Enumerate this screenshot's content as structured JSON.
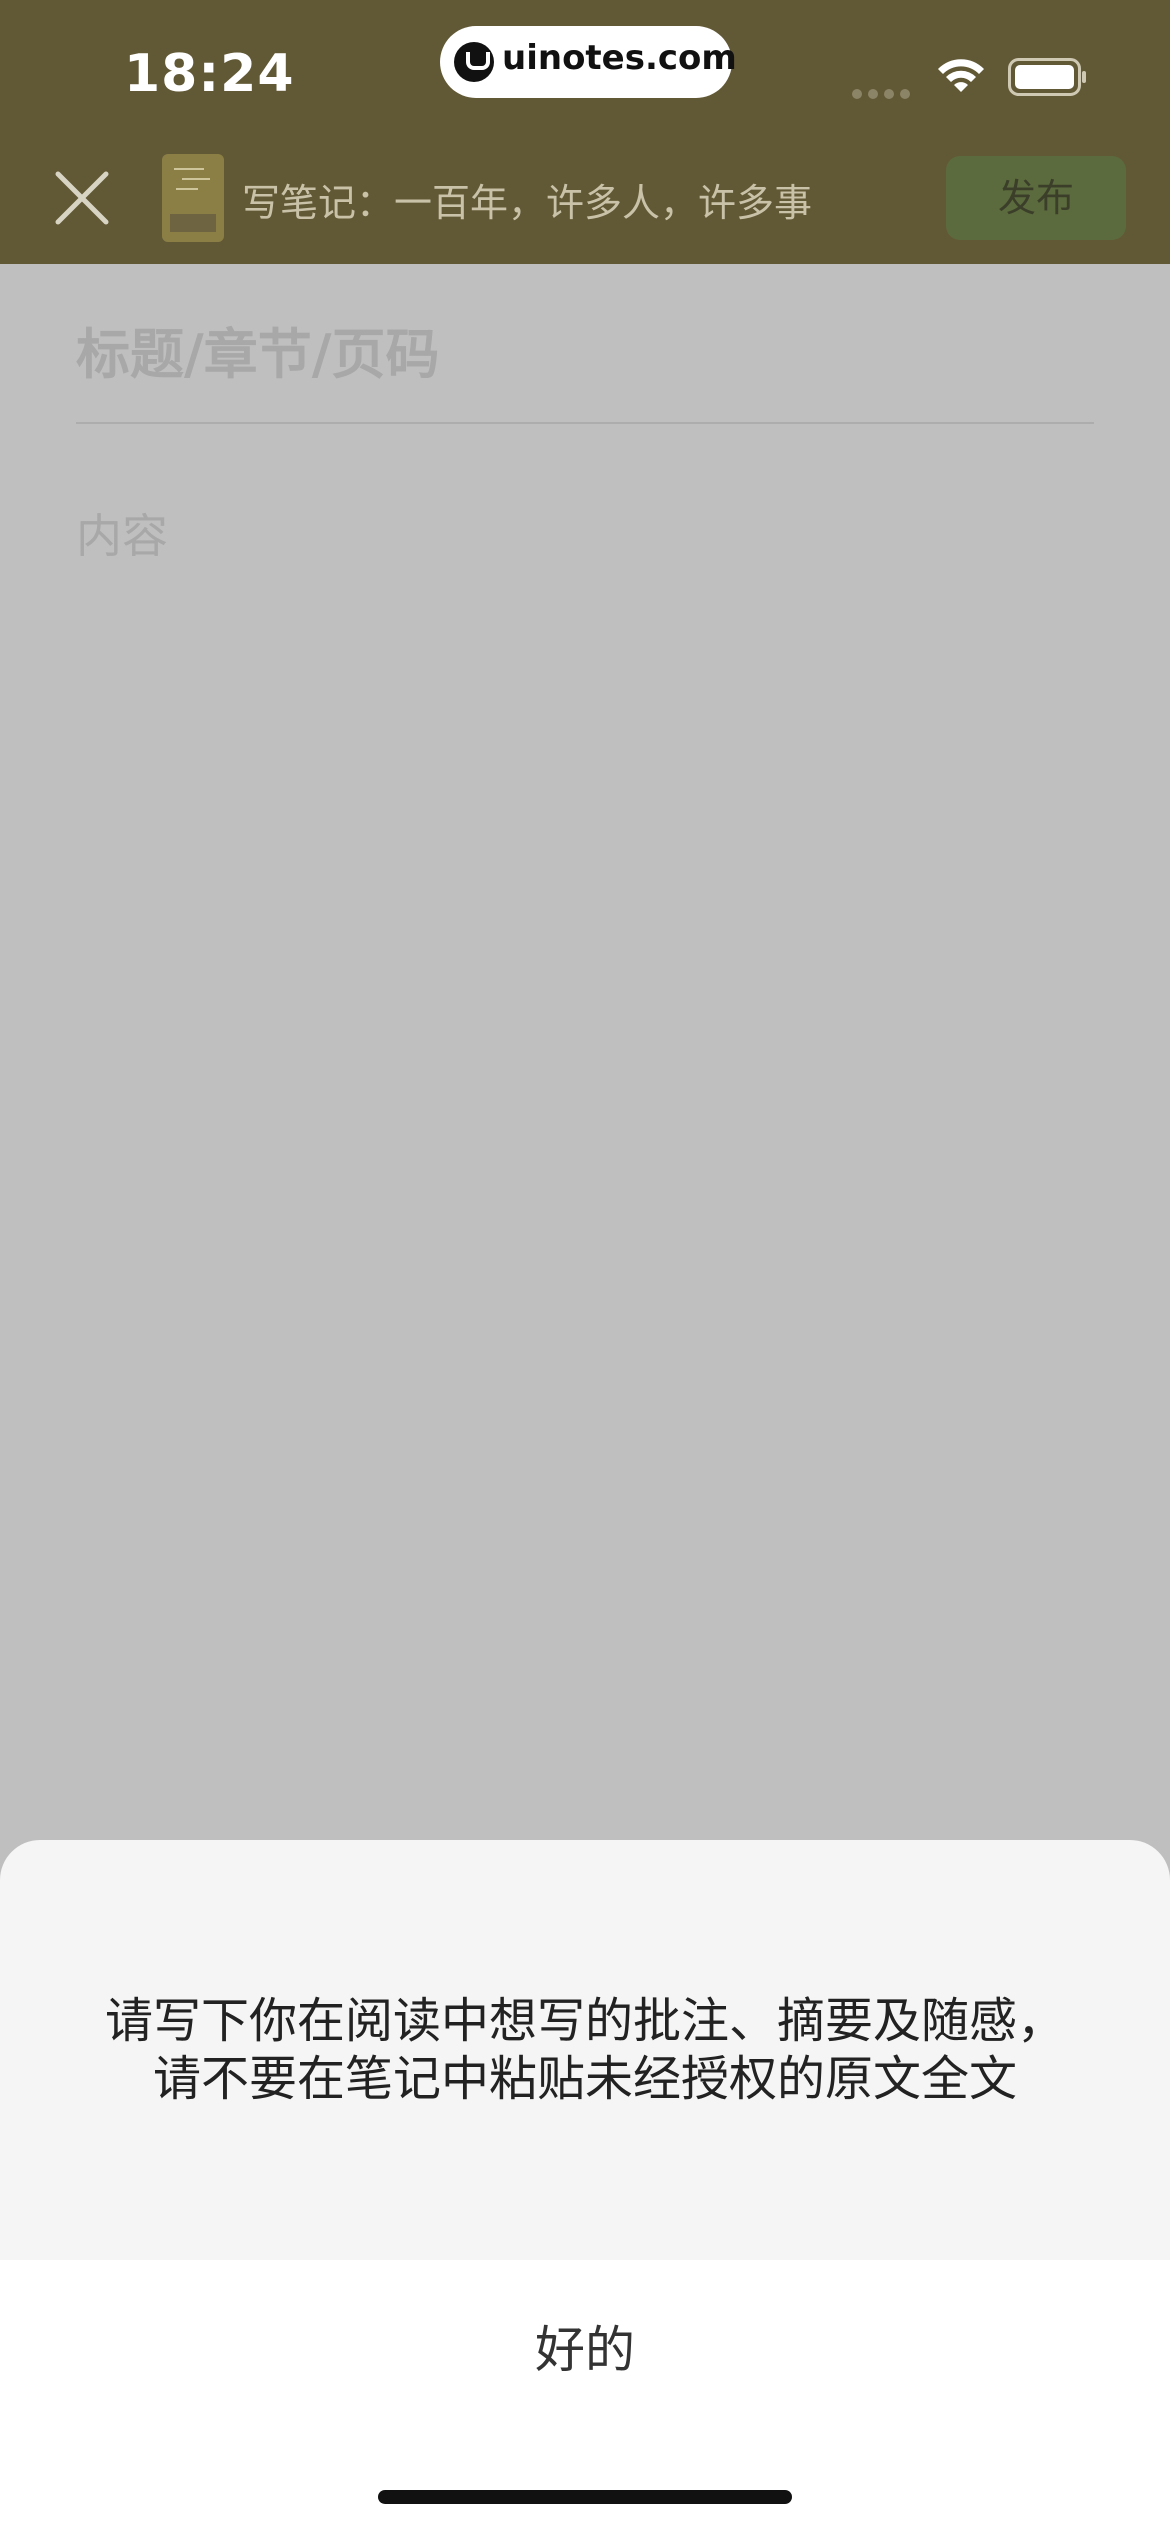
{
  "status_bar": {
    "time": "18:24",
    "watermark": "uinotes.com"
  },
  "header": {
    "title": "写笔记：一百年，许多人，许多事",
    "publish_label": "发布"
  },
  "editor": {
    "title_placeholder": "标题/章节/页码",
    "content_placeholder": "内容"
  },
  "dialog": {
    "message_line1": "请写下你在阅读中想写的批注、摘要及随感，",
    "message_line2": "请不要在笔记中粘贴未经授权的原文全文",
    "ok_label": "好的"
  },
  "colors": {
    "header_bg": "#615835",
    "publish_bg": "#5c6b3e",
    "overlay_bg": "#bfbfbf",
    "sheet_bg": "#f5f5f5"
  }
}
